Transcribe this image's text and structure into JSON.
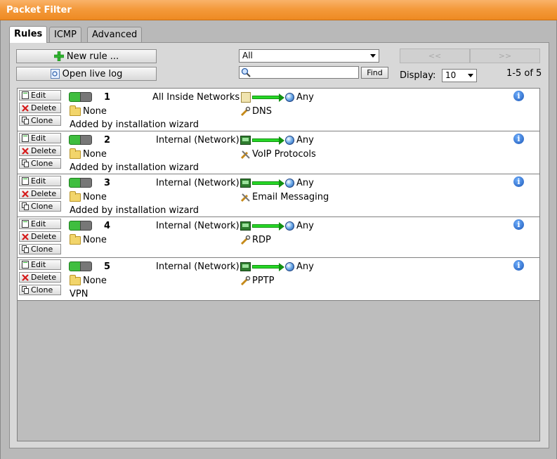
{
  "window": {
    "title": "Packet Filter"
  },
  "tabs": [
    {
      "label": "Rules",
      "active": true
    },
    {
      "label": "ICMP",
      "active": false
    },
    {
      "label": "Advanced",
      "active": false
    }
  ],
  "toolbar": {
    "new_rule": "New rule ...",
    "open_live_log": "Open live log",
    "filter_value": "All",
    "search_placeholder": "",
    "find_label": "Find",
    "prev_label": "<<",
    "next_label": ">>",
    "display_label": "Display:",
    "display_value": "10",
    "range_text": "1-5 of 5"
  },
  "row_buttons": {
    "edit": "Edit",
    "delete": "Delete",
    "clone": "Clone"
  },
  "rules": [
    {
      "number": "1",
      "source": "All Inside Networks",
      "source_icon": "document-icon",
      "destination": "Any",
      "group": "None",
      "service": "DNS",
      "comment": "Added by installation wizard",
      "enabled": true
    },
    {
      "number": "2",
      "source": "Internal (Network)",
      "source_icon": "network-card-icon",
      "destination": "Any",
      "group": "None",
      "service": "VoIP Protocols",
      "comment": "Added by installation wizard",
      "enabled": true
    },
    {
      "number": "3",
      "source": "Internal (Network)",
      "source_icon": "network-card-icon",
      "destination": "Any",
      "group": "None",
      "service": "Email Messaging",
      "comment": "Added by installation wizard",
      "enabled": true
    },
    {
      "number": "4",
      "source": "Internal (Network)",
      "source_icon": "network-card-icon",
      "destination": "Any",
      "group": "None",
      "service": "RDP",
      "comment": "",
      "enabled": true
    },
    {
      "number": "5",
      "source": "Internal (Network)",
      "source_icon": "network-card-icon",
      "destination": "Any",
      "group": "None",
      "service": "PPTP",
      "comment": "VPN",
      "enabled": true
    }
  ],
  "colors": {
    "title_orange": "#f49a3c",
    "enabled_green": "#3fbe3f",
    "info_blue": "#1a55b5"
  }
}
